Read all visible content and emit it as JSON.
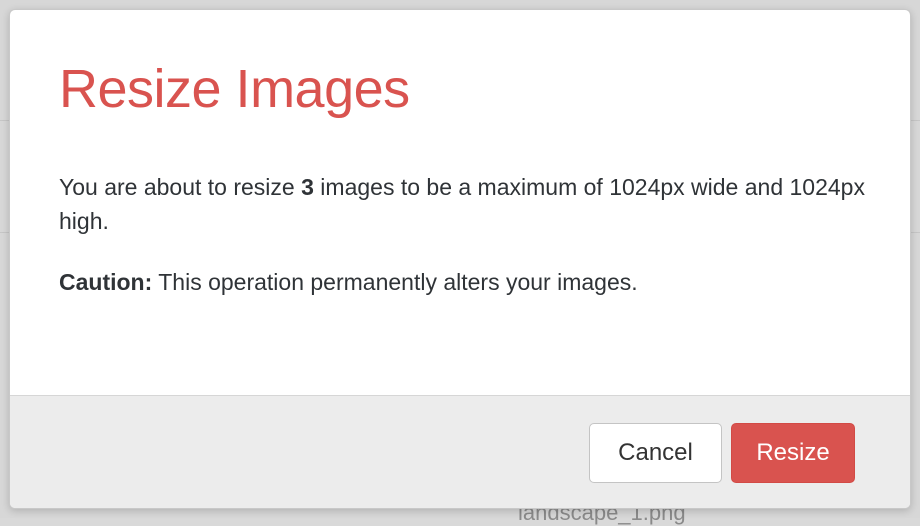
{
  "background": {
    "filename_label": "landscape_1.png"
  },
  "dialog": {
    "title": "Resize Images",
    "message": {
      "prefix": "You are about to resize ",
      "count": "3",
      "suffix": " images to be a maximum of 1024px wide and 1024px high."
    },
    "caution": {
      "label": "Caution:",
      "text": " This operation permanently alters your images."
    },
    "buttons": {
      "cancel_label": "Cancel",
      "resize_label": "Resize"
    }
  },
  "colors": {
    "title": "#d9534f",
    "primary_button": "#d9534f",
    "footer_background": "#ececec"
  }
}
